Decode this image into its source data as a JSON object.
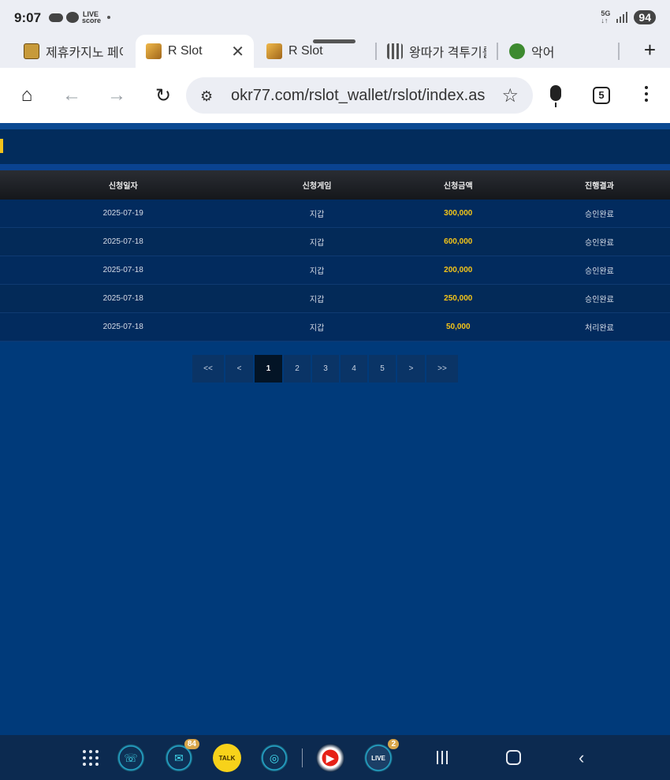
{
  "status": {
    "time": "9:07",
    "live_line1": "LIVE",
    "live_line2": "score",
    "net_line1": "5G",
    "net_line2": "↓↑",
    "battery": "94"
  },
  "tabs": [
    {
      "title": "제휴카지노 페이"
    },
    {
      "title": "R Slot"
    },
    {
      "title": "R Slot"
    },
    {
      "title": "왕따가 격투기를"
    },
    {
      "title": "악어"
    }
  ],
  "toolbar": {
    "url": "okr77.com/rslot_wallet/rslot/index.as",
    "tab_count": "5"
  },
  "table": {
    "headers": [
      "신청일자",
      "신청게임",
      "신청금액",
      "진행결과"
    ],
    "rows": [
      {
        "date": "2025-07-19",
        "game": "지갑",
        "amount": "300,000",
        "result": "승인완료"
      },
      {
        "date": "2025-07-18",
        "game": "지갑",
        "amount": "600,000",
        "result": "승인완료"
      },
      {
        "date": "2025-07-18",
        "game": "지갑",
        "amount": "200,000",
        "result": "승인완료"
      },
      {
        "date": "2025-07-18",
        "game": "지갑",
        "amount": "250,000",
        "result": "승인완료"
      },
      {
        "date": "2025-07-18",
        "game": "지갑",
        "amount": "50,000",
        "result": "처리완료"
      }
    ]
  },
  "pagination": {
    "first": "<<",
    "prev": "<",
    "pages": [
      "1",
      "2",
      "3",
      "4",
      "5"
    ],
    "current": "1",
    "next": ">",
    "last": ">>"
  },
  "navbar": {
    "kakao_label": "TALK",
    "live_label": "LIVE",
    "badge_chat": "84",
    "badge_live": "2"
  }
}
